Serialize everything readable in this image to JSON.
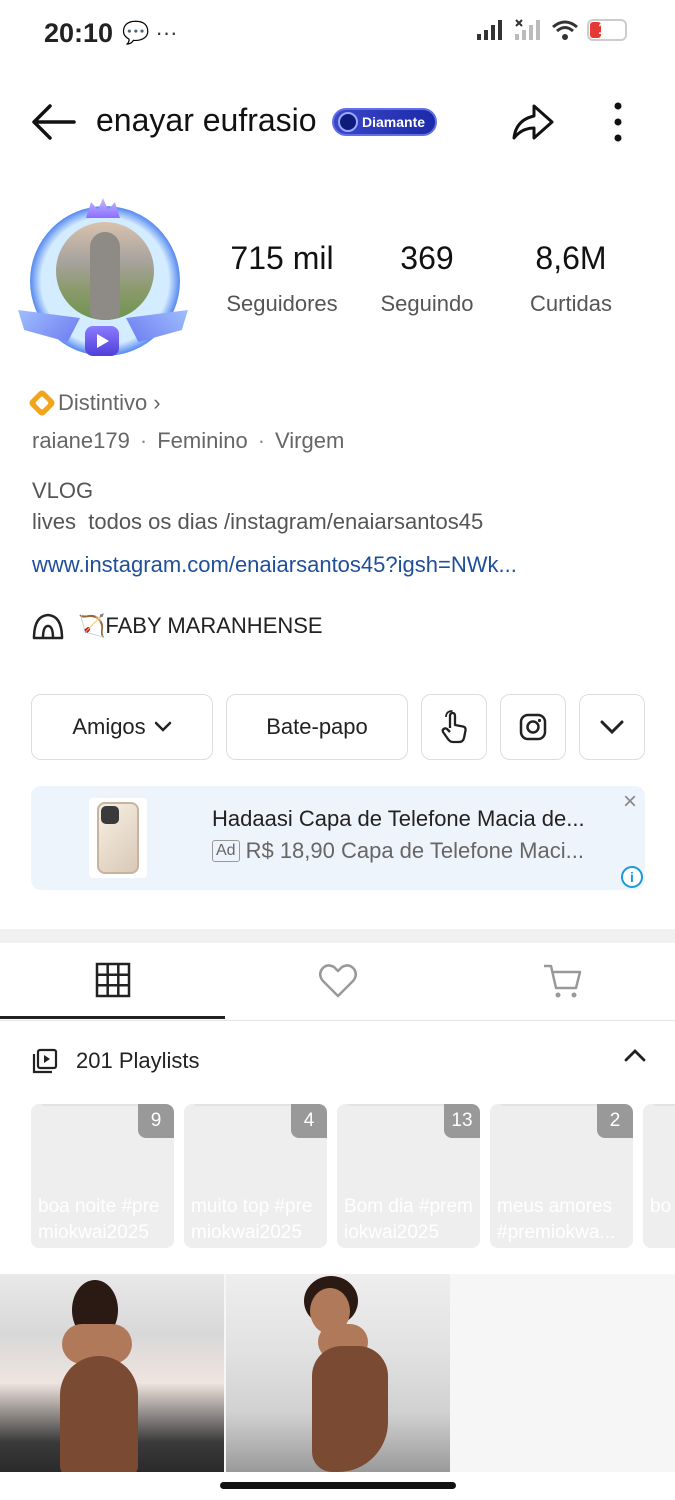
{
  "status_bar": {
    "time": "20:10",
    "left_icons": "💬 ···",
    "battery_level": "18",
    "battery_color": "#e53935"
  },
  "header": {
    "username": "enayar eufrasio",
    "badge_label": "Diamante",
    "back_icon": "arrow-left-icon",
    "share_icon": "share-arrow-icon",
    "more_icon": "more-vertical-icon"
  },
  "stats": [
    {
      "value": "715 mil",
      "label": "Seguidores"
    },
    {
      "value": "369",
      "label": "Seguindo"
    },
    {
      "value": "8,6M",
      "label": "Curtidas"
    }
  ],
  "profile": {
    "distintivo_label": "Distintivo",
    "handle": "raiane179",
    "gender": "Feminino",
    "sign": "Virgem",
    "bio_title": "VLOG",
    "bio_text": "lives  todos os dias /instagram/enaiarsantos45",
    "link": "www.instagram.com/enaiarsantos45?igsh=NWk...",
    "group_name": "🏹FABY MARANHENSE"
  },
  "actions": {
    "friends_label": "Amigos",
    "chat_label": "Bate-papo"
  },
  "ad": {
    "title": "Hadaasi Capa de Telefone Macia de...",
    "tag": "Ad",
    "description": "R$ 18,90 Capa de Telefone Maci...",
    "close": "×",
    "info": "i"
  },
  "tabs": [
    "grid-icon",
    "heart-icon",
    "cart-icon"
  ],
  "playlists": {
    "title": "201 Playlists",
    "items": [
      {
        "count": "9",
        "label": "boa noite #premiokwai2025"
      },
      {
        "count": "4",
        "label": "muito top #premiokwai2025"
      },
      {
        "count": "13",
        "label": "Bom dia #premiokwai2025"
      },
      {
        "count": "2",
        "label": "meus amores #premiokwa..."
      },
      {
        "count": "",
        "label": "bo em"
      }
    ]
  },
  "colors": {
    "link": "#1f4f9a",
    "ad_bg": "#eef4fb",
    "badge": "#2433b8",
    "distintivo": "#f2a51a"
  }
}
